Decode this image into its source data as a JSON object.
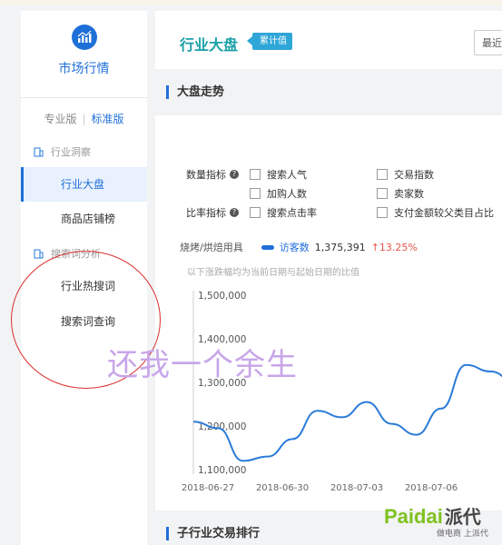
{
  "sidebar": {
    "title": "市场行情",
    "edition_pro": "专业版",
    "edition_std": "标准版",
    "groups": {
      "insight": "行业洞察",
      "keyword": "搜索词分析"
    },
    "items": {
      "industry_market": "行业大盘",
      "store_ranking": "商品店铺榜",
      "hot_keywords": "行业热搜词",
      "keyword_query": "搜索词查询"
    }
  },
  "header": {
    "title": "行业大盘",
    "tag": "累计值",
    "date_label": "最近"
  },
  "section": {
    "trend": "大盘走势",
    "sub_ranking": "子行业交易排行"
  },
  "metrics": {
    "quantity_label": "数量指标",
    "ratio_label": "比率指标",
    "options": {
      "search_popularity": "搜索人气",
      "trade_index": "交易指数",
      "cart_users": "加购人数",
      "seller_count": "卖家数",
      "search_ctr": "搜索点击率",
      "pay_amount_share": "支付金额较父类目占比"
    }
  },
  "legend": {
    "category": "烧烤/烘焙用具",
    "series": "访客数",
    "value": "1,375,391",
    "change": "13.25%",
    "arrow": "↑"
  },
  "note": "以下涨跌幅均为当前日期与起始日期的比值",
  "colors": {
    "accent": "#1f6fd8",
    "title_teal": "#1aa0a6",
    "up": "#e5534b"
  },
  "chart_data": {
    "type": "line",
    "title": "",
    "xlabel": "",
    "ylabel": "",
    "ylim": [
      1100000,
      1500000
    ],
    "yticks": [
      1100000,
      1200000,
      1300000,
      1400000,
      1500000
    ],
    "ytick_labels": [
      "1,100,000",
      "1,200,000",
      "1,300,000",
      "1,400,000",
      "1,500,000"
    ],
    "xtick_labels": [
      "2018-06-27",
      "2018-06-30",
      "2018-07-03",
      "2018-07-06"
    ],
    "series": [
      {
        "name": "访客数",
        "x": [
          "2018-06-26",
          "2018-06-27",
          "2018-06-28",
          "2018-06-29",
          "2018-06-30",
          "2018-07-01",
          "2018-07-02",
          "2018-07-03",
          "2018-07-04",
          "2018-07-05",
          "2018-07-06",
          "2018-07-07",
          "2018-07-08",
          "2018-07-09"
        ],
        "values": [
          1210000,
          1195000,
          1120000,
          1130000,
          1170000,
          1235000,
          1220000,
          1255000,
          1205000,
          1180000,
          1240000,
          1340000,
          1325000,
          1300000
        ]
      }
    ]
  },
  "watermark": "还我一个余生",
  "brand": {
    "latin": "Paidai",
    "chinese": "派代",
    "slogan": "做电商 上派代"
  }
}
